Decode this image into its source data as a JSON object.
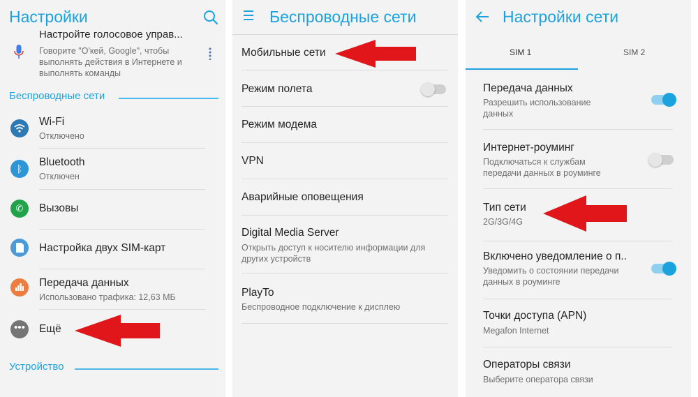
{
  "colors": {
    "accent": "#1ca3de",
    "arrow": "#e0161b",
    "background": "#f3f3f3"
  },
  "panel1": {
    "title": "Настройки",
    "search_icon": "search-icon",
    "voice": {
      "title": "Настройте голосовое управ...",
      "desc": "Говорите \"О'кей, Google\", чтобы выполнять действия в Интернете и выполнять команды"
    },
    "section_wireless": "Беспроводные сети",
    "items": [
      {
        "label": "Wi-Fi",
        "sub": "Отключено",
        "icon": "wifi-icon",
        "color": "#2d79b3"
      },
      {
        "label": "Bluetooth",
        "sub": "Отключен",
        "icon": "bluetooth-icon",
        "color": "#2e95d6"
      },
      {
        "label": "Вызовы",
        "sub": "",
        "icon": "phone-icon",
        "color": "#22a34b"
      },
      {
        "label": "Настройка двух SIM-карт",
        "sub": "",
        "icon": "sim-card-icon",
        "color": "#4d9ad9"
      },
      {
        "label": "Передача данных",
        "sub": "Использовано трафика: 12,63 МБ",
        "icon": "data-usage-icon",
        "color": "#ea7d3f"
      },
      {
        "label": "Ещё",
        "sub": "",
        "icon": "more-icon",
        "color": "#757575"
      }
    ],
    "section_device": "Устройство"
  },
  "panel2": {
    "title": "Беспроводные сети",
    "items": [
      {
        "label": "Мобильные сети",
        "sub": ""
      },
      {
        "label": "Режим полета",
        "sub": "",
        "toggle": "off"
      },
      {
        "label": "Режим модема",
        "sub": ""
      },
      {
        "label": "VPN",
        "sub": ""
      },
      {
        "label": "Аварийные оповещения",
        "sub": ""
      },
      {
        "label": "Digital Media Server",
        "sub": "Открыть доступ к носителю информации для других устройств"
      },
      {
        "label": "PlayTo",
        "sub": "Беспроводное подключение к дисплею"
      }
    ]
  },
  "panel3": {
    "title": "Настройки сети",
    "tabs": [
      "SIM 1",
      "SIM 2"
    ],
    "active_tab": "SIM 1",
    "items": [
      {
        "label": "Передача данных",
        "sub": "Разрешить использование данных",
        "toggle": "on"
      },
      {
        "label": "Интернет-роуминг",
        "sub": "Подключаться к службам передачи данных в роуминге",
        "toggle": "off"
      },
      {
        "label": "Тип сети",
        "sub": "2G/3G/4G"
      },
      {
        "label": "Включено уведомление о п..",
        "sub": "Уведомить о состоянии передачи данных в роуминге",
        "toggle": "on"
      },
      {
        "label": "Точки доступа (APN)",
        "sub": "Megafon Internet"
      },
      {
        "label": "Операторы связи",
        "sub": "Выберите оператора связи"
      }
    ]
  }
}
